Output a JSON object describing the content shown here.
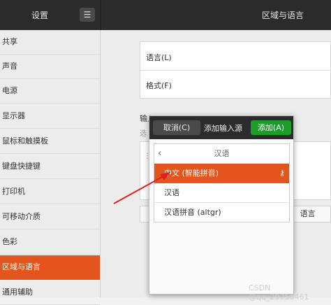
{
  "header": {
    "settings_title": "设置",
    "menu_icon": "hamburger-icon",
    "window_title": "区域与语言"
  },
  "sidebar": {
    "items": [
      {
        "label": "共享"
      },
      {
        "label": "声音"
      },
      {
        "label": "电源"
      },
      {
        "label": "显示器"
      },
      {
        "label": "鼠标和触摸板"
      },
      {
        "label": "键盘快捷键"
      },
      {
        "label": "打印机"
      },
      {
        "label": "可移动介质"
      },
      {
        "label": "色彩"
      },
      {
        "label": "区域与语言"
      },
      {
        "label": "通用辅助"
      }
    ],
    "active_index": 9
  },
  "main": {
    "language_label": "语言(L)",
    "formats_label": "格式(F)",
    "input_sources_title": "输入",
    "input_sources_sub": "选",
    "options_button_tail": "语言"
  },
  "dialog": {
    "cancel_label": "取消(C)",
    "title": "添加输入源",
    "add_label": "添加(A)",
    "list_header": "汉语",
    "rows": [
      {
        "label": "中文 (智能拼音)",
        "selected": true
      },
      {
        "label": "汉语",
        "selected": false
      },
      {
        "label": "汉语拼音 (altgr)",
        "selected": false
      }
    ]
  },
  "watermark": "CSDN @qq_29750461",
  "colors": {
    "accent": "#e4551d",
    "add_button": "#1e9c2a",
    "header_bg": "#2b2b2b",
    "arrow": "#e02020"
  }
}
